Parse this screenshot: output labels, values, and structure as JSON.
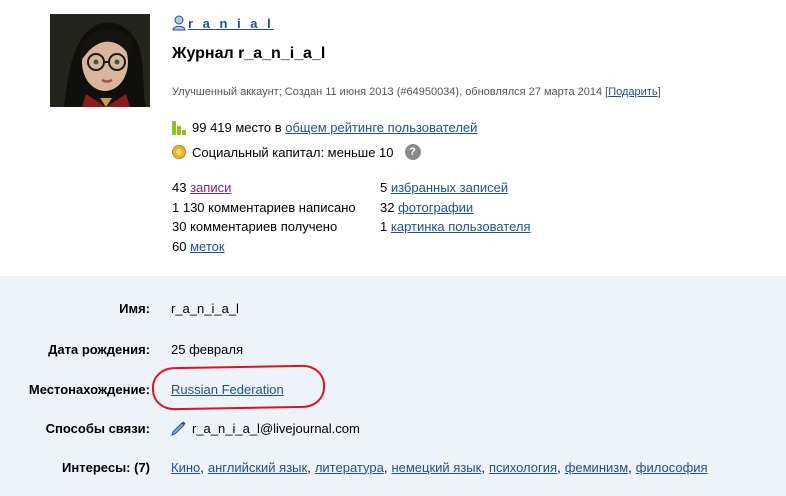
{
  "header": {
    "username": "r a n i a l",
    "journal_title": "Журнал r_a_n_i_a_l",
    "account_info": "Улучшенный аккаунт; Создан 11 июня 2013 (#64950034),  обновлялся 27 марта 2014",
    "gift_open": "[",
    "gift_link": "Подарить",
    "gift_close": "]"
  },
  "rating": {
    "value": "99 419 место в",
    "link": "общем рейтинге пользователей"
  },
  "capital": {
    "text": "Социальный капитал: меньше 10",
    "help": "?"
  },
  "stats_left": [
    {
      "count": "43",
      "link": "записи",
      "text": ""
    },
    {
      "count": "1 130 комментариев написано",
      "link": "",
      "text": ""
    },
    {
      "count": "30 комментариев получено",
      "link": "",
      "text": ""
    },
    {
      "count": "60",
      "link": "меток",
      "text": ""
    }
  ],
  "stats_right": [
    {
      "count": "5",
      "link": "избранных записей"
    },
    {
      "count": "32",
      "link": "фотографии"
    },
    {
      "count": "1",
      "link": "картинка пользователя"
    }
  ],
  "profile": {
    "name_label": "Имя:",
    "name_value": "r_a_n_i_a_l",
    "birthday_label": "Дата рождения:",
    "birthday_value": "25 февраля",
    "location_label": "Местонахождение:",
    "location_value": "Russian Federation",
    "contact_label": "Способы связи:",
    "contact_value": "r_a_n_i_a_l@livejournal.com",
    "interests_label": "Интересы: (7)",
    "interests": [
      "Кино",
      "английский язык",
      "литература",
      "немецкий язык",
      "психология",
      "феминизм",
      "философия"
    ]
  },
  "colors": {
    "link": "#1f4f96",
    "visited_link": "#8c1e8c",
    "profile_bg": "#edf3f8",
    "highlight": "#e0121b"
  },
  "icons": {
    "user": "user-icon",
    "rating": "bar-chart-icon",
    "capital": "coin-icon",
    "help": "help-icon",
    "contact": "pencil-icon"
  }
}
